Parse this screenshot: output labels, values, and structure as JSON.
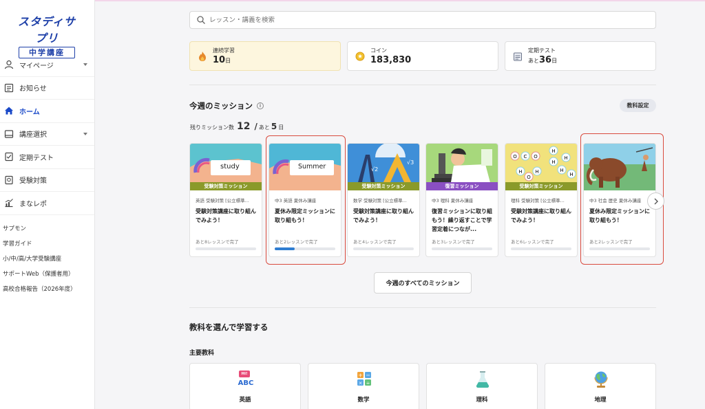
{
  "sidebar": {
    "logo_main": "スタディサプリ",
    "logo_sub": "中学講座",
    "nav": [
      {
        "label": "マイページ",
        "icon": "user-icon",
        "caret": true
      },
      {
        "label": "お知らせ",
        "icon": "notice-icon",
        "caret": false
      },
      {
        "label": "ホーム",
        "icon": "home-icon",
        "caret": false,
        "active": true
      },
      {
        "label": "講座選択",
        "icon": "course-icon",
        "caret": true
      },
      {
        "label": "定期テスト",
        "icon": "test-icon",
        "caret": false
      },
      {
        "label": "受験対策",
        "icon": "exam-icon",
        "caret": false
      },
      {
        "label": "まなレポ",
        "icon": "chart-icon",
        "caret": false
      }
    ],
    "links": [
      "サプモン",
      "学習ガイド",
      "小/中/高/大学受験講座",
      "サポートWeb（保護者用）",
      "高校合格報告（2026年度）"
    ]
  },
  "search": {
    "placeholder": "レッスン・講義を検索"
  },
  "stats": {
    "streak": {
      "label": "連続学習",
      "value": "10",
      "unit": "日"
    },
    "coin": {
      "label": "コイン",
      "value": "183,830"
    },
    "test": {
      "label": "定期テスト",
      "prefix": "あと",
      "value": "36",
      "unit": "日"
    }
  },
  "missions": {
    "title": "今週のミッション",
    "info_icon": "i",
    "subject_setting": "教科設定",
    "remaining_label": "残りミッション数",
    "remaining_count": "12",
    "slash": "/",
    "days_prefix": "あと",
    "days_value": "5",
    "days_unit": "日",
    "cards": [
      {
        "tag": "受験対策ミッション",
        "tag_color": "#8a9a2a",
        "meta": "英語 受験対策 [公立標準...",
        "title": "受験対策講座に取り組んでみよう！",
        "left": "あと8レッスンで完了",
        "progress": 0,
        "thumb_text": "study",
        "bg": "#5cc3cf"
      },
      {
        "tag": "",
        "tag_color": "",
        "meta": "中3 英語 夏休み講座",
        "title": "夏休み限定ミッションに取り組もう！",
        "left": "あと2レッスンで完了",
        "progress": 0.33,
        "thumb_text": "Summer",
        "bg": "#4fb7d6"
      },
      {
        "tag": "受験対策ミッション",
        "tag_color": "#8a9a2a",
        "meta": "数学 受験対策 [公立標準...",
        "title": "受験対策講座に取り組んでみよう！",
        "left": "あと4レッスンで完了",
        "progress": 0,
        "thumb_text": "",
        "bg": "#3f8fd8"
      },
      {
        "tag": "復習ミッション",
        "tag_color": "#8a4fc2",
        "meta": "中3 理科 夏休み講座",
        "title": "復習ミッションに取り組もう！繰り返すことで学習定着につなが...",
        "left": "あと3レッスンで完了",
        "progress": 0,
        "thumb_text": "",
        "bg": "#a7d87c"
      },
      {
        "tag": "受験対策ミッション",
        "tag_color": "#8a9a2a",
        "meta": "理科 受験対策 [公立標準...",
        "title": "受験対策講座に取り組んでみよう！",
        "left": "あと6レッスンで完了",
        "progress": 0,
        "thumb_text": "",
        "bg": "#f1e27c"
      },
      {
        "tag": "",
        "tag_color": "",
        "meta": "中3 社会 歴史 夏休み講座",
        "title": "夏休み限定ミッションに取り組もう！",
        "left": "あと2レッスンで完了",
        "progress": 0,
        "thumb_text": "",
        "bg": "#73b978"
      }
    ],
    "all_button": "今週のすべてのミッション"
  },
  "subjects": {
    "title": "教科を選んで学習する",
    "major": "主要教科",
    "items": [
      {
        "label": "英語",
        "icon": "english-icon",
        "icon_text": "ABC",
        "badge": "Hi!"
      },
      {
        "label": "数学",
        "icon": "math-icon"
      },
      {
        "label": "理科",
        "icon": "science-icon"
      },
      {
        "label": "地理",
        "icon": "globe-icon"
      }
    ]
  },
  "colors": {
    "accent": "#1a49c8",
    "highlight": "#d94a3d",
    "progress": "#2f7dd1",
    "streak_bg": "#fdf6de"
  }
}
